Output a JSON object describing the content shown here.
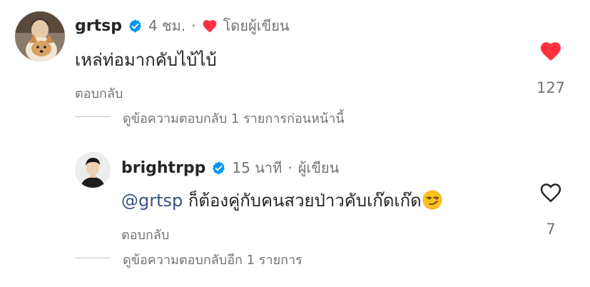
{
  "comments": [
    {
      "username": "grtsp",
      "time": "4 ชม.",
      "separator": "·",
      "author_badge": "โดยผู้เขียน",
      "text": "เหล่ท่อมากคับไบ้ไบ้",
      "reply_label": "ตอบกลับ",
      "like_count": "127",
      "liked": true,
      "view_replies": "ดูข้อความตอบกลับ 1 รายการก่อนหน้านี้"
    },
    {
      "username": "brightrpp",
      "time": "15 นาที",
      "separator": "·",
      "author_badge": "ผู้เขียน",
      "mention": "@grtsp",
      "text": "ก็ต้องคู่กับคนสวยป่าวคับเก๊ดเก๊ด",
      "emoji": "😏",
      "reply_label": "ตอบกลับ",
      "like_count": "7",
      "liked": false,
      "view_replies": "ดูข้อความตอบกลับอีก 1 รายการ"
    }
  ],
  "colors": {
    "verified_blue": "#0095f6",
    "like_red": "#ff3040",
    "secondary_text": "#737373",
    "mention_blue": "#385185"
  },
  "icons": {
    "verified": "verified-badge-icon",
    "heart_filled": "heart-filled-icon",
    "heart_outline": "heart-outline-icon"
  }
}
